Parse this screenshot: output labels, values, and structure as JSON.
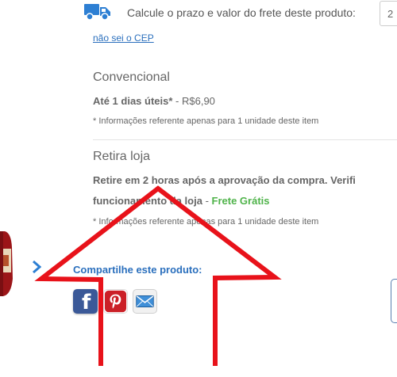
{
  "shipping": {
    "calc_label": "Calcule o prazo e valor do frete deste produto:",
    "cep_value": "2",
    "cep_link": "não sei o CEP"
  },
  "options": [
    {
      "title": "Convencional",
      "line_bold": "Até 1 dias úteis*",
      "line_rest": " - R$6,90",
      "note": "* Informações referente apenas para 1 unidade deste item"
    },
    {
      "title": "Retira loja",
      "line1": "Retire em 2 horas após a aprovação da compra. Verifi",
      "line2_bold": "funcionamento da loja",
      "line2_sep": " - ",
      "line2_free": "Frete Grátis",
      "note": "* Informações referente apenas para 1 unidade deste item"
    }
  ],
  "share": {
    "label": "Compartilhe este produto:",
    "icons": [
      "facebook-icon",
      "pinterest-icon",
      "email-icon"
    ]
  },
  "colors": {
    "link": "#2a6fbd",
    "free_shipping": "#4fb34a",
    "annotation_arrow": "#e8121a",
    "facebook": "#3b5998",
    "pinterest": "#cb2027"
  }
}
